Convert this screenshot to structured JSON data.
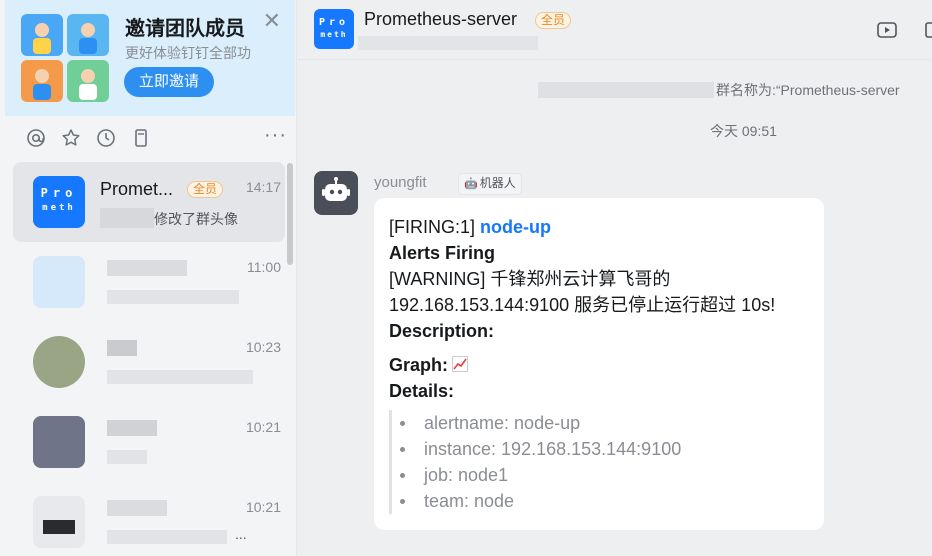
{
  "invite": {
    "title": "邀请团队成员",
    "subtitle": "更好体验钉钉全部功",
    "button": "立即邀请",
    "close_icon": "close-icon"
  },
  "toolbar": {
    "icons": [
      "at-icon",
      "star-icon",
      "history-icon",
      "document-icon"
    ],
    "more": "···"
  },
  "conversations": [
    {
      "name": "Promet...",
      "badge": "全员",
      "time": "14:17",
      "preview": "修改了群头像",
      "avatar_text": "Pro meth",
      "active": true
    },
    {
      "name": "",
      "time": "11:00",
      "preview": ""
    },
    {
      "name": "",
      "time": "10:23",
      "preview": ""
    },
    {
      "name": "",
      "time": "10:21",
      "preview": ""
    },
    {
      "name": "",
      "time": "10:21",
      "preview": "..."
    }
  ],
  "header": {
    "title": "Prometheus-server",
    "badge": "全员",
    "avatar_line1": "Pro",
    "avatar_line2": "meth",
    "icons": [
      "video-icon",
      "window-icon"
    ]
  },
  "chat": {
    "system_notice": "群名称为:“Prometheus-server",
    "timestamp": "今天 09:51",
    "sender": "youngfit",
    "sender_tag": "机器人",
    "message": {
      "firing_prefix": "[FIRING:1] ",
      "firing_link": "node-up",
      "alerts_heading": "Alerts Firing",
      "warning_line1": "[WARNING] 千锋郑州云计算飞哥的",
      "warning_line2": "192.168.153.144:9100 服务已停止运行超过 10s!",
      "description_label": "Description:",
      "graph_label": "Graph:",
      "details_label": "Details:",
      "details": [
        "alertname: node-up",
        "instance: 192.168.153.144:9100",
        "job: node1",
        "team: node"
      ]
    }
  },
  "colors": {
    "accent": "#1677ff",
    "badge": "#e9891e",
    "invite_bg": "#dbeefc"
  }
}
